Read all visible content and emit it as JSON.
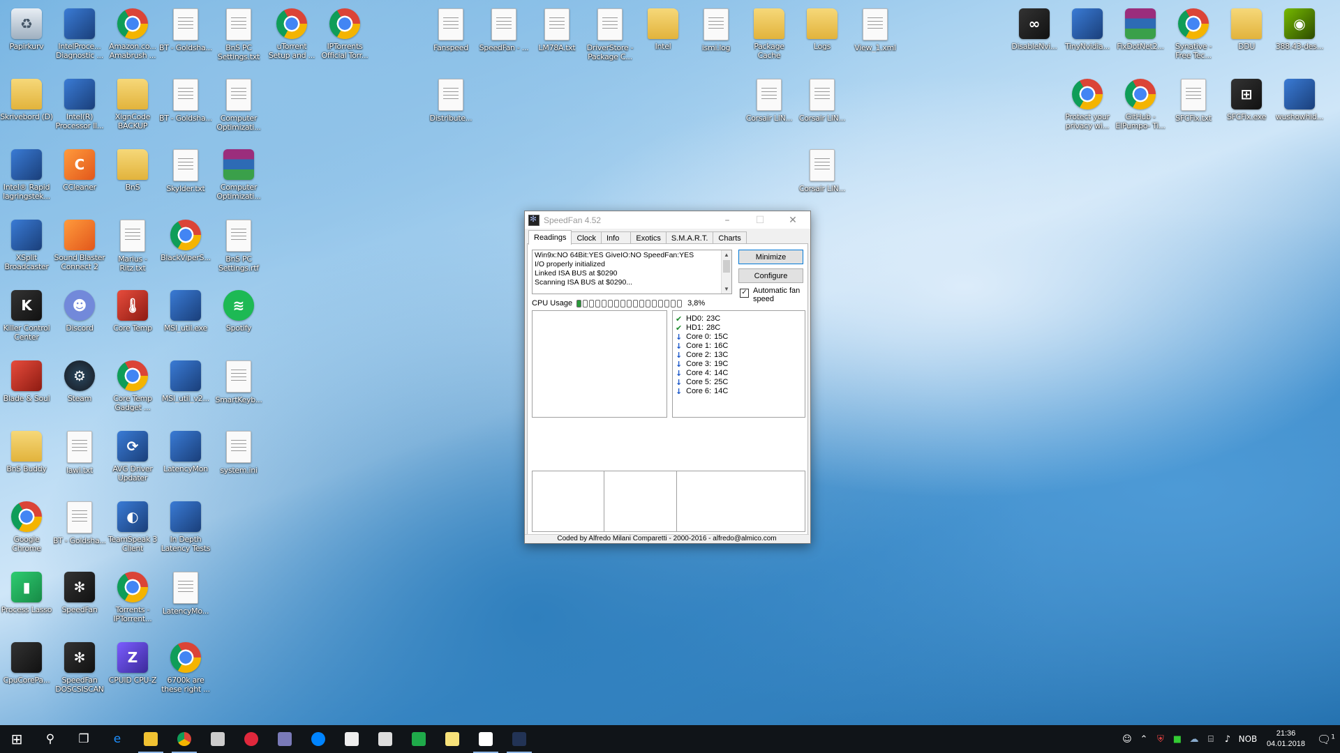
{
  "desktop_icons": [
    {
      "label": "Papirkurv",
      "icon": "recycle-bin-icon"
    },
    {
      "label": "IntelProce... Diagnostic ...",
      "icon": "app-icon"
    },
    {
      "label": "Amazon.co... Amabrush ...",
      "icon": "chrome-icon"
    },
    {
      "label": "BT - Goldsha...",
      "icon": "document-icon"
    },
    {
      "label": "BnS PC Settings.txt",
      "icon": "document-icon"
    },
    {
      "label": "uTorrent Setup and ...",
      "icon": "chrome-icon"
    },
    {
      "label": "IPTorrents Official Torr...",
      "icon": "chrome-icon"
    },
    {
      "label": "Fanspeed",
      "icon": "pdf-icon"
    },
    {
      "label": "SpeedFan - ...",
      "icon": "document-icon"
    },
    {
      "label": "LM78A.txt",
      "icon": "document-icon"
    },
    {
      "label": "DriverStore - Package C...",
      "icon": "document-icon"
    },
    {
      "label": "Intel",
      "icon": "folder-icon"
    },
    {
      "label": "ismi.log",
      "icon": "document-icon"
    },
    {
      "label": "Package Cache",
      "icon": "folder-icon"
    },
    {
      "label": "Logs",
      "icon": "folder-icon"
    },
    {
      "label": "View_1.xml",
      "icon": "xml-icon"
    },
    {
      "label": "DisableNvi...",
      "icon": "binoculars-icon"
    },
    {
      "label": "TinyNvidia...",
      "icon": "app-icon"
    },
    {
      "label": "FixDotNet2...",
      "icon": "winrar-icon"
    },
    {
      "label": "Synative - Free Tec...",
      "icon": "chrome-icon"
    },
    {
      "label": "DDU",
      "icon": "folder-icon"
    },
    {
      "label": "388.43-des...",
      "icon": "nvidia-icon"
    },
    {
      "label": "Skrivebord (D)",
      "icon": "folder-icon"
    },
    {
      "label": "Intel(R) Processor Il...",
      "icon": "app-icon"
    },
    {
      "label": "XignCode BACKUP",
      "icon": "folder-icon"
    },
    {
      "label": "BT - Goldsha...",
      "icon": "document-icon"
    },
    {
      "label": "Computer Optimizati...",
      "icon": "document-icon"
    },
    {
      "label": "Distribute...",
      "icon": "document-icon"
    },
    {
      "label": "Corsair LIN...",
      "icon": "document-icon"
    },
    {
      "label": "Corsair LIN...",
      "icon": "document-icon"
    },
    {
      "label": "Protect your privacy wi...",
      "icon": "chrome-icon"
    },
    {
      "label": "GitHub - ElPumpo- Ti...",
      "icon": "chrome-icon"
    },
    {
      "label": "SFCFix.txt",
      "icon": "document-icon"
    },
    {
      "label": "SFCFix.exe",
      "icon": "windows-icon"
    },
    {
      "label": "wushowhid...",
      "icon": "app-icon"
    },
    {
      "label": "Intel® Rapid lagringstek...",
      "icon": "app-icon"
    },
    {
      "label": "CCleaner",
      "icon": "ccleaner-icon"
    },
    {
      "label": "BnS",
      "icon": "folder-icon"
    },
    {
      "label": "Skylder.txt",
      "icon": "document-icon"
    },
    {
      "label": "Computer Optimizati...",
      "icon": "winrar-icon"
    },
    {
      "label": "Corsair LIN...",
      "icon": "document-icon"
    },
    {
      "label": "XSplit Broadcaster",
      "icon": "app-icon"
    },
    {
      "label": "Sound Blaster Connect 2",
      "icon": "soundblaster-icon"
    },
    {
      "label": "Marius - Ritz.txt",
      "icon": "document-icon"
    },
    {
      "label": "BlackViperS...",
      "icon": "chrome-icon"
    },
    {
      "label": "BnS PC Settings.rtf",
      "icon": "document-icon"
    },
    {
      "label": "Killer Control Center",
      "icon": "killer-icon"
    },
    {
      "label": "Discord",
      "icon": "discord-icon"
    },
    {
      "label": "Core Temp",
      "icon": "thermometer-icon"
    },
    {
      "label": "MSI_util.exe",
      "icon": "app-icon"
    },
    {
      "label": "Spotify",
      "icon": "spotify-icon"
    },
    {
      "label": "Blade & Soul",
      "icon": "game-icon"
    },
    {
      "label": "Steam",
      "icon": "steam-icon"
    },
    {
      "label": "Core Temp Gadget ...",
      "icon": "chrome-icon"
    },
    {
      "label": "MSI_util_v2...",
      "icon": "app-icon"
    },
    {
      "label": "SmartKeyb...",
      "icon": "document-icon"
    },
    {
      "label": "BnS Buddy",
      "icon": "folder-icon"
    },
    {
      "label": "lawl.txt",
      "icon": "document-icon"
    },
    {
      "label": "AVG Driver Updater",
      "icon": "avg-icon"
    },
    {
      "label": "LatencyMon",
      "icon": "app-icon"
    },
    {
      "label": "system.ini",
      "icon": "settings-file-icon"
    },
    {
      "label": "Google Chrome",
      "icon": "chrome-icon"
    },
    {
      "label": "BT - Goldsha...",
      "icon": "document-icon"
    },
    {
      "label": "TeamSpeak 3 Client",
      "icon": "teamspeak-icon"
    },
    {
      "label": "In Depth Latency Tests",
      "icon": "app-icon"
    },
    {
      "label": "Process Lasso",
      "icon": "process-lasso-icon"
    },
    {
      "label": "SpeedFan",
      "icon": "speedfan-icon"
    },
    {
      "label": "Torrents - IPTorrent...",
      "icon": "chrome-icon"
    },
    {
      "label": "LatencyMo...",
      "icon": "document-icon"
    },
    {
      "label": "CpuCorePa...",
      "icon": "chip-icon"
    },
    {
      "label": "SpeedFan DOSCSISCAN",
      "icon": "speedfan-icon"
    },
    {
      "label": "CPUID CPU-Z",
      "icon": "cpuz-icon"
    },
    {
      "label": "6700k are these right ...",
      "icon": "chrome-icon"
    }
  ],
  "speedfan": {
    "title": "SpeedFan 4.52",
    "window_controls": {
      "minimize": "–",
      "maximize": "☐",
      "close": "✕"
    },
    "tabs": [
      "Readings",
      "Clock",
      "Info",
      "Exotics",
      "S.M.A.R.T.",
      "Charts"
    ],
    "active_tab": "Readings",
    "log_lines": [
      "Win9x:NO  64Bit:YES  GiveIO:NO  SpeedFan:YES",
      "I/O properly initialized",
      "Linked ISA BUS at $0290",
      "Scanning ISA BUS at $0290..."
    ],
    "buttons": {
      "minimize": "Minimize",
      "configure": "Configure"
    },
    "auto_fan_label": "Automatic fan speed",
    "auto_fan_checked": true,
    "cpu_usage_label": "CPU Usage",
    "cpu_usage_value": "3,8%",
    "cpu_usage_fraction": 0.038,
    "temps": [
      {
        "name": "HD0:",
        "value": "23C",
        "status": "ok"
      },
      {
        "name": "HD1:",
        "value": "28C",
        "status": "ok"
      },
      {
        "name": "Core 0:",
        "value": "15C",
        "status": "down"
      },
      {
        "name": "Core 1:",
        "value": "16C",
        "status": "down"
      },
      {
        "name": "Core 2:",
        "value": "13C",
        "status": "down"
      },
      {
        "name": "Core 3:",
        "value": "19C",
        "status": "down"
      },
      {
        "name": "Core 4:",
        "value": "14C",
        "status": "down"
      },
      {
        "name": "Core 5:",
        "value": "25C",
        "status": "down"
      },
      {
        "name": "Core 6:",
        "value": "14C",
        "status": "down"
      }
    ],
    "status_bar": "Coded by Alfredo Milani Comparetti - 2000-2016 - alfredo@almico.com"
  },
  "taskbar": {
    "start_icon": "windows-start-icon",
    "items": [
      {
        "name": "search-icon",
        "glyph": "⚲"
      },
      {
        "name": "task-view-icon",
        "glyph": "❐"
      },
      {
        "name": "edge-icon",
        "glyph": "e",
        "color": "#1e90ff"
      },
      {
        "name": "file-explorer-icon",
        "color": "#f1c232"
      },
      {
        "name": "chrome-icon",
        "color": "#db4437"
      },
      {
        "name": "security-app-icon",
        "color": "#cccccc"
      },
      {
        "name": "app-red-icon",
        "color": "#e0283c"
      },
      {
        "name": "messenger-badge-icon",
        "color": "#7a7ab8"
      },
      {
        "name": "messenger-icon",
        "color": "#0084ff"
      },
      {
        "name": "mail-icon",
        "color": "#eeeeee"
      },
      {
        "name": "photos-icon",
        "color": "#dddddd"
      },
      {
        "name": "process-lasso-icon",
        "color": "#1faa4a"
      },
      {
        "name": "notepad-icon",
        "color": "#f7e27a"
      },
      {
        "name": "media-icon",
        "color": "#ffffff"
      },
      {
        "name": "speedfan-icon",
        "color": "#223355"
      }
    ],
    "language": "NOB",
    "time": "21:36",
    "date": "04.01.2018",
    "notification_count": "1"
  }
}
